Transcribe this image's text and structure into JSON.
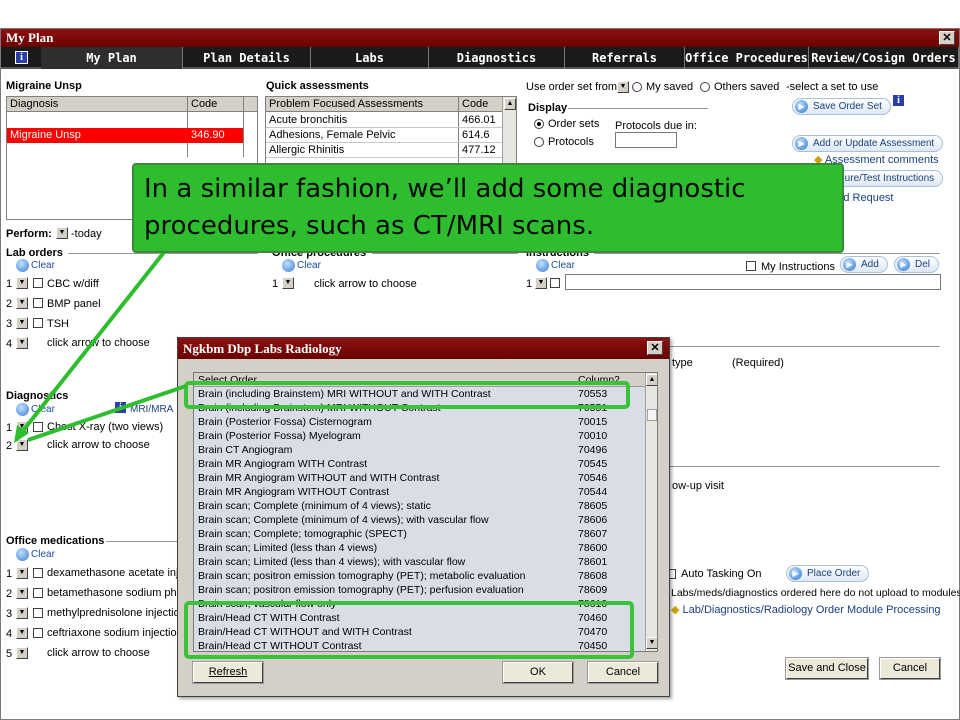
{
  "window": {
    "title": "My Plan",
    "close_glyph": "✕"
  },
  "tabs": [
    "My Plan",
    "Plan Details",
    "Labs",
    "Diagnostics",
    "Referrals",
    "Office Procedures",
    "Review/Cosign Orders"
  ],
  "diagnosis_panel": {
    "title": "Migraine Unsp",
    "headers": [
      "Diagnosis",
      "Code"
    ],
    "rows": [
      {
        "diagnosis": "Migraine Unsp",
        "code": "346.90"
      }
    ],
    "highlight_color": "#ff0000"
  },
  "quick_assessments": {
    "title": "Quick assessments",
    "headers": [
      "Problem Focused Assessments",
      "Code"
    ],
    "rows": [
      {
        "name": "Acute bronchitis",
        "code": "466.01"
      },
      {
        "name": "Adhesions, Female Pelvic",
        "code": "614.6"
      },
      {
        "name": "Allergic Rhinitis",
        "code": "477.12"
      }
    ]
  },
  "order_set": {
    "use_label": "Use order set from:",
    "my_saved": "My saved",
    "others_saved": "Others saved",
    "hint": "-select a set to use",
    "display_label": "Display",
    "order_sets": "Order sets",
    "protocols": "Protocols",
    "protocols_due": "Protocols due in:",
    "save_order_set": "Save Order Set"
  },
  "right_actions": {
    "add_update_assessment": "Add or Update Assessment",
    "assessment_comments": "Assessment comments",
    "procedure_test_instructions": "Procedure/Test Instructions",
    "record_request": "Record Request"
  },
  "perform": {
    "label": "Perform:",
    "value": "-today"
  },
  "lab_orders": {
    "title": "Lab orders",
    "clear": "Clear",
    "items": [
      {
        "num": "1",
        "name": "CBC w/diff"
      },
      {
        "num": "2",
        "name": "BMP panel"
      },
      {
        "num": "3",
        "name": "TSH"
      },
      {
        "num": "4",
        "name": "click arrow to choose"
      }
    ]
  },
  "office_procedures": {
    "title": "Office procedures",
    "clear": "Clear",
    "items": [
      {
        "num": "1",
        "name": "click arrow to choose"
      }
    ]
  },
  "instructions": {
    "title": "Instructions",
    "clear": "Clear",
    "my_instructions": "My Instructions",
    "add": "Add",
    "del": "Del",
    "num": "1"
  },
  "diagnostics": {
    "title": "Diagnostics",
    "clear": "Clear",
    "mri_link": "MRI/MRA",
    "items": [
      {
        "num": "1",
        "name": "Chest X-ray (two views)"
      },
      {
        "num": "2",
        "name": "click arrow to choose"
      }
    ]
  },
  "partial_labels": {
    "type_label": "type",
    "required": "(Required)",
    "followup": "ow-up visit",
    "auto_tasking": "Auto Tasking On",
    "place_order": "Place Order",
    "upload_note": "Labs/meds/diagnostics ordered here do not upload to modules.)",
    "module_processing": "Lab/Diagnostics/Radiology Order Module Processing"
  },
  "office_medications": {
    "title": "Office medications",
    "clear": "Clear",
    "items": [
      {
        "num": "1",
        "name": "dexamethasone acetate injec"
      },
      {
        "num": "2",
        "name": "betamethasone sodium phos"
      },
      {
        "num": "3",
        "name": "methylprednisolone injection"
      },
      {
        "num": "4",
        "name": "ceftriaxone sodium injection"
      },
      {
        "num": "5",
        "name": "click arrow to choose"
      }
    ]
  },
  "footer_buttons": {
    "save_close": "Save and Close",
    "cancel": "Cancel"
  },
  "dialog": {
    "title": "Ngkbm Dbp Labs Radiology",
    "close_glyph": "✕",
    "headers": [
      "Select Order",
      "Column2"
    ],
    "rows": [
      {
        "name": "Brain (including Brainstem) MRI WITHOUT and WITH Contrast",
        "code": "70553"
      },
      {
        "name": "Brain (including Brainstem) MRI WITHOUT Contrast",
        "code": "70551"
      },
      {
        "name": "Brain (Posterior Fossa) Cisternogram",
        "code": "70015"
      },
      {
        "name": "Brain (Posterior Fossa) Myelogram",
        "code": "70010"
      },
      {
        "name": "Brain CT Angiogram",
        "code": "70496"
      },
      {
        "name": "Brain MR Angiogram WITH Contrast",
        "code": "70545"
      },
      {
        "name": "Brain MR Angiogram WITHOUT and WITH Contrast",
        "code": "70546"
      },
      {
        "name": "Brain MR Angiogram WITHOUT Contrast",
        "code": "70544"
      },
      {
        "name": "Brain scan; Complete (minimum of 4 views); static",
        "code": "78605"
      },
      {
        "name": "Brain scan; Complete (minimum of 4 views); with vascular flow",
        "code": "78606"
      },
      {
        "name": "Brain scan; Complete; tomographic (SPECT)",
        "code": "78607"
      },
      {
        "name": "Brain scan; Limited (less than 4 views)",
        "code": "78600"
      },
      {
        "name": "Brain scan; Limited (less than 4 views); with vascular flow",
        "code": "78601"
      },
      {
        "name": "Brain scan; positron emission tomography (PET); metabolic evaluation",
        "code": "78608"
      },
      {
        "name": "Brain scan; positron emission tomography (PET); perfusion evaluation",
        "code": "78609"
      },
      {
        "name": "Brain scan; vascular flow only",
        "code": "78610"
      },
      {
        "name": "Brain/Head CT WITH Contrast",
        "code": "70460"
      },
      {
        "name": "Brain/Head CT WITHOUT and WITH Contrast",
        "code": "70470"
      },
      {
        "name": "Brain/Head CT WITHOUT Contrast",
        "code": "70450"
      }
    ],
    "refresh": "Refresh",
    "ok": "OK",
    "cancel": "Cancel"
  },
  "callout": {
    "text": "In a similar fashion, we’ll add some diagnostic procedures, such as CT/MRI scans.",
    "color": "#2ebd2e"
  }
}
